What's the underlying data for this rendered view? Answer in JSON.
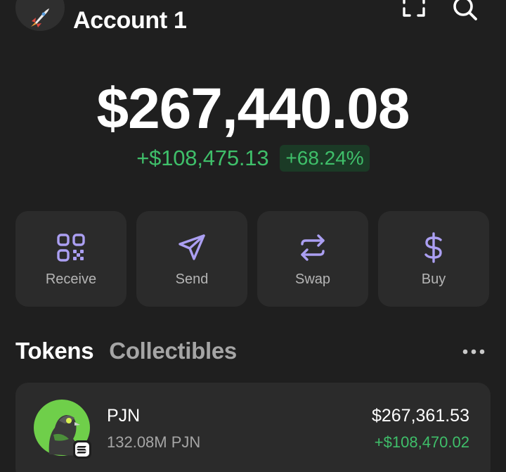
{
  "header": {
    "account_name": "Account 1",
    "avatar_icon": "rocket-icon",
    "scan_icon": "scan-icon",
    "search_icon": "search-icon"
  },
  "balance": {
    "total": "$267,440.08",
    "change_amount": "+$108,475.13",
    "change_percent": "+68.24%"
  },
  "actions": [
    {
      "label": "Receive",
      "icon": "qr-code-icon"
    },
    {
      "label": "Send",
      "icon": "send-icon"
    },
    {
      "label": "Swap",
      "icon": "swap-icon"
    },
    {
      "label": "Buy",
      "icon": "dollar-icon"
    }
  ],
  "tabs": {
    "tokens": "Tokens",
    "collectibles": "Collectibles",
    "active": "Tokens",
    "more_icon": "more-icon"
  },
  "tokens": [
    {
      "symbol": "PJN",
      "amount": "132.08M PJN",
      "value": "$267,361.53",
      "change": "+$108,470.02",
      "logo_icon": "pigeon-token-icon",
      "chain_badge_icon": "solana-icon"
    }
  ],
  "colors": {
    "background": "#1f1f1f",
    "card": "#2b2b2b",
    "accent_purple": "#ab9ff2",
    "positive_green": "#3fbf6a",
    "muted_text": "#a5a5a5"
  }
}
